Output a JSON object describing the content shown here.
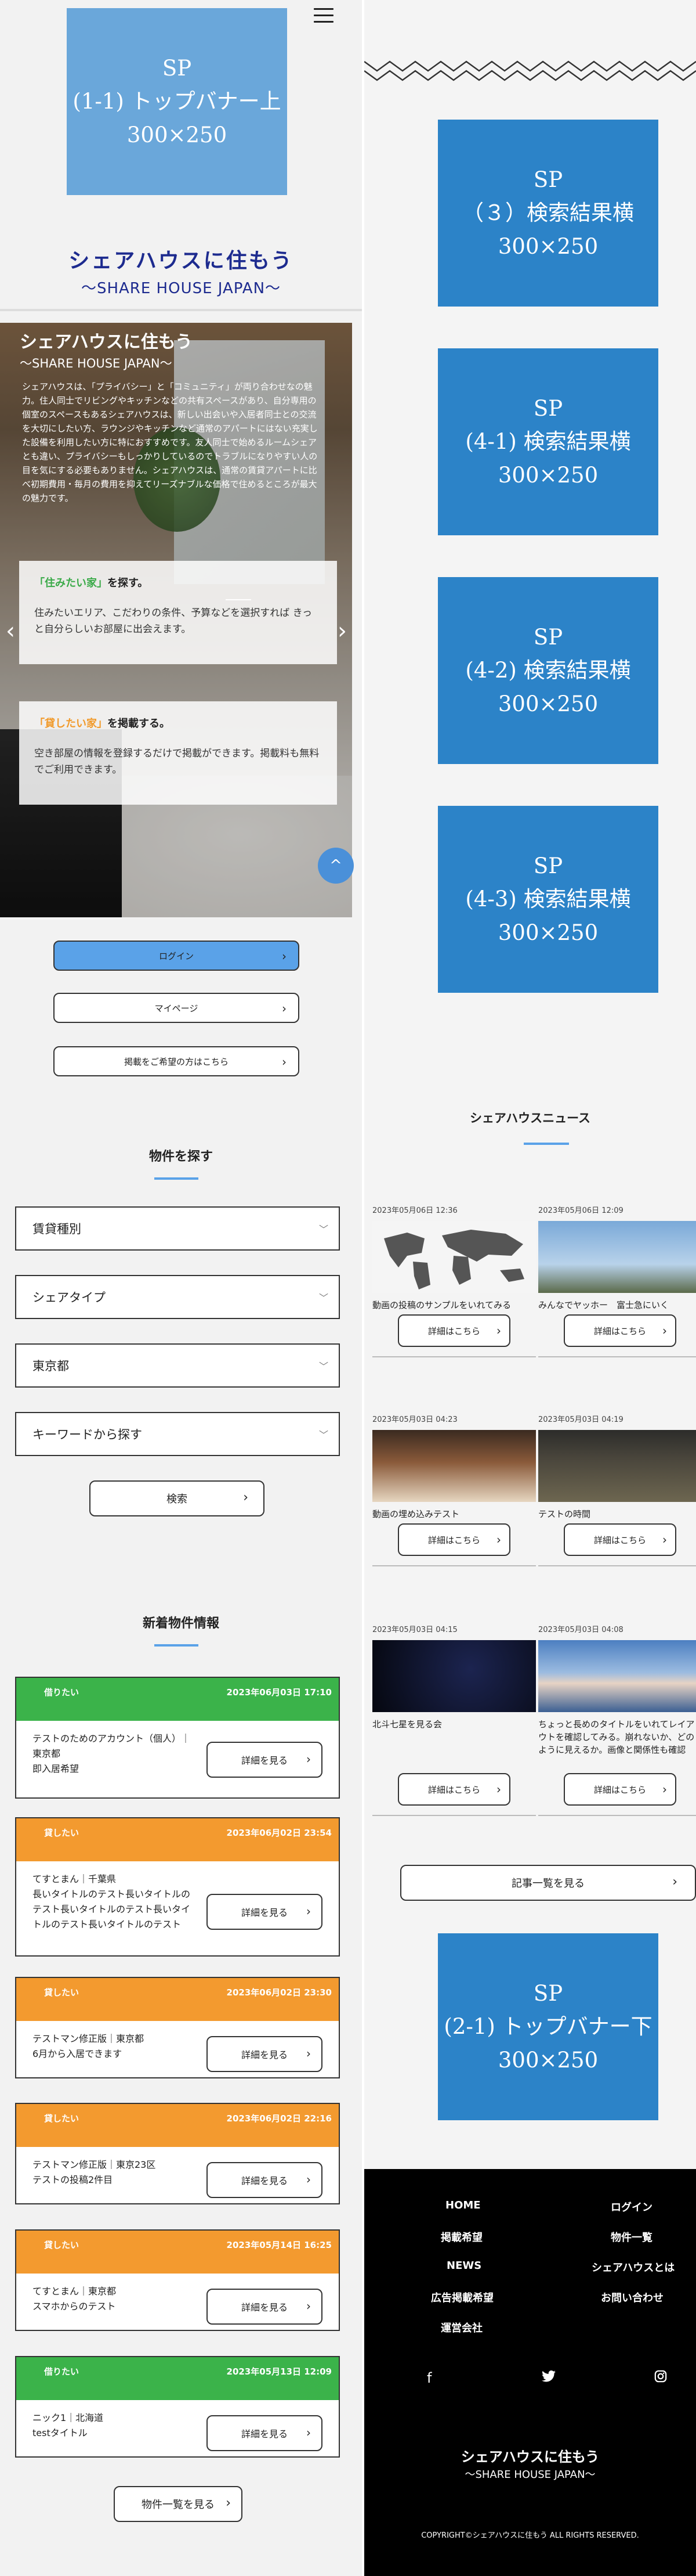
{
  "header": {
    "banner_top": [
      "SP",
      "(1-1) トップバナー上",
      "300×250"
    ],
    "title": "シェアハウスに住もう",
    "subtitle": "〜SHARE HOUSE JAPAN〜"
  },
  "hero": {
    "title": "シェアハウスに住もう",
    "subtitle": "〜SHARE HOUSE JAPAN〜",
    "description": "シェアハウスは、「プライバシー」と「コミュニティ」が両り合わせなの魅力。住人同士でリビングやキッチンなどの共有スペースがあり、自分専用の個室のスペースもあるシェアハウスは、新しい出会いや入居者同士との交流を大切にしたい方、ラウンジやキッチンなど通常のアパートにはない充実した設備を利用したい方に特におすすめです。友人同士で始めるルームシェアとも違い、プライバシーもしっかりしているのでトラブルになりやすい人の目を気にする必要もありません。シェアハウスは、通常の賃貸アパートに比べ初期費用・毎月の費用を抑えてリーズナブルな価格で住めるところが最大の魅力です。",
    "card1": {
      "quote": "「住みたい家」",
      "rest": "を探す。",
      "body": "住みたいエリア、こだわりの条件、予算などを選択すれば きっと自分らしいお部屋に出会えます。"
    },
    "card2": {
      "quote": "「貸したい家」",
      "rest": "を掲載する。",
      "body": "空き部屋の情報を登録するだけで掲載ができます。掲載料も無料でご利用できます。"
    },
    "arrow_left": "‹",
    "arrow_right": "›",
    "to_top": "^"
  },
  "auth": {
    "login": "ログイン",
    "mypage": "マイページ",
    "listing": "掲載をご希望の方はこちら"
  },
  "search": {
    "title": "物件を探す",
    "fields": [
      "賃貸種別",
      "シェアタイプ",
      "東京都",
      "キーワードから探す"
    ],
    "button": "検索"
  },
  "new_listings": {
    "title": "新着物件情報",
    "detail_label": "詳細を見る",
    "items": [
      {
        "type": "借りたい",
        "color": "#3bb34a",
        "date": "2023年06月03日 17:10",
        "lines": [
          "テストのためのアカウント（個人）｜",
          "東京都",
          "即入居希望"
        ]
      },
      {
        "type": "貸したい",
        "color": "#f39a2f",
        "date": "2023年06月02日 23:54",
        "lines": [
          "てすとまん｜千葉県",
          "長いタイトルのテスト長いタイトルの",
          "テスト長いタイトルのテスト長いタイ",
          "トルのテスト長いタイトルのテスト"
        ]
      },
      {
        "type": "貸したい",
        "color": "#f39a2f",
        "date": "2023年06月02日 23:30",
        "lines": [
          "テストマン修正版｜東京都",
          "6月から入居できます"
        ]
      },
      {
        "type": "貸したい",
        "color": "#f39a2f",
        "date": "2023年06月02日 22:16",
        "lines": [
          "テストマン修正版｜東京23区",
          "テストの投稿2件目"
        ]
      },
      {
        "type": "貸したい",
        "color": "#f39a2f",
        "date": "2023年05月14日 16:25",
        "lines": [
          "てすとまん｜東京都",
          "スマホからのテスト"
        ]
      },
      {
        "type": "借りたい",
        "color": "#3bb34a",
        "date": "2023年05月13日 12:09",
        "lines": [
          "ニック1｜北海道",
          "testタイトル"
        ]
      }
    ],
    "more": "物件一覧を見る"
  },
  "right_banners": [
    [
      "SP",
      "（３）検索結果横",
      "300×250"
    ],
    [
      "SP",
      "(4-1) 検索結果横",
      "300×250"
    ],
    [
      "SP",
      "(4-2) 検索結果横",
      "300×250"
    ],
    [
      "SP",
      "(4-3) 検索結果横",
      "300×250"
    ]
  ],
  "news": {
    "title": "シェアハウスニュース",
    "detail_label": "詳細はこちら",
    "items": [
      {
        "date": "2023年05月06日 12:36",
        "title": "動画の投稿のサンプルをいれてみる",
        "thumb": "world-map"
      },
      {
        "date": "2023年05月06日 12:09",
        "title": "みんなでヤッホー　富士急にいく",
        "thumb": "roller-coaster"
      },
      {
        "date": "2023年05月03日 04:23",
        "title": "動画の埋め込みテスト",
        "thumb": "party-food"
      },
      {
        "date": "2023年05月03日 04:19",
        "title": "テストの時間",
        "thumb": "seminar-room"
      },
      {
        "date": "2023年05月03日 04:15",
        "title": "北斗七星を見る会",
        "thumb": "night-sky"
      },
      {
        "date": "2023年05月03日 04:08",
        "title": "ちょっと長めのタイトルをいれてレイアウトを確認してみる。崩れないか、どのように見えるか。画像と関係性も確認",
        "thumb": "mount-fuji"
      }
    ],
    "more": "記事一覧を見る"
  },
  "banner_bottom": [
    "SP",
    "(2-1) トップバナー下",
    "300×250"
  ],
  "footer": {
    "nav_left": [
      "HOME",
      "掲載希望",
      "NEWS",
      "広告掲載希望",
      "運営会社"
    ],
    "nav_right": [
      "ログイン",
      "物件一覧",
      "シェアハウスとは",
      "お問い合わせ"
    ],
    "social": [
      "facebook-icon",
      "twitter-icon",
      "instagram-icon"
    ],
    "title": "シェアハウスに住もう",
    "subtitle": "〜SHARE HOUSE JAPAN〜",
    "copyright": "COPYRIGHT©シェアハウスに住もう ALL RIGHTS RESERVED."
  },
  "colors": {
    "primary": "#1d2b8f",
    "accent": "#5aa2e8",
    "banner": "#6aa7da",
    "banner_dark": "#2c83c8",
    "green": "#3bb34a",
    "orange": "#f39a2f"
  }
}
